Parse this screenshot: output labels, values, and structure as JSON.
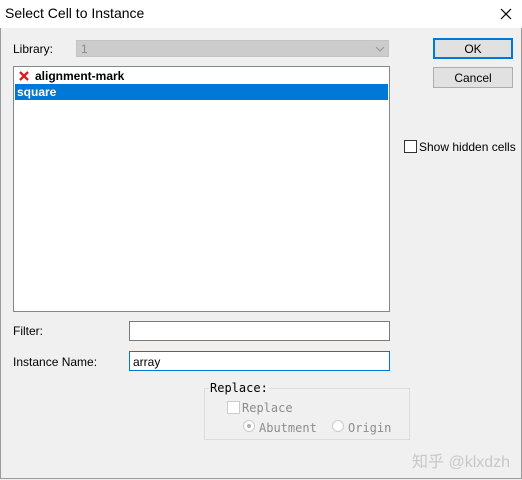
{
  "window": {
    "title": "Select Cell to Instance"
  },
  "library": {
    "label": "Library:",
    "value": "1"
  },
  "cell_list": {
    "items": [
      {
        "label": "alignment-mark",
        "icon": "red-x-icon",
        "selected": false
      },
      {
        "label": "square",
        "selected": true
      }
    ]
  },
  "buttons": {
    "ok": "OK",
    "cancel": "Cancel"
  },
  "show_hidden": {
    "label": "Show hidden cells",
    "checked": false
  },
  "filter": {
    "label": "Filter:",
    "value": ""
  },
  "instance_name": {
    "label": "Instance Name:",
    "value": "array"
  },
  "replace_group": {
    "legend": "Replace:",
    "replace_label": "Replace",
    "abutment_label": "Abutment",
    "origin_label": "Origin",
    "selected_option": "Abutment"
  },
  "watermark": "知乎 @klxdzh",
  "colors": {
    "selection": "#0078d7",
    "error_icon": "#d42020"
  }
}
